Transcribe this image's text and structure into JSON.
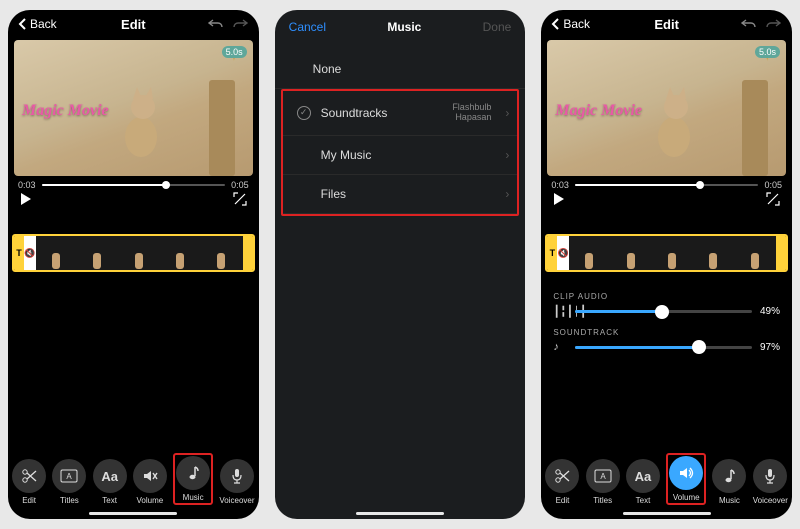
{
  "panel1": {
    "nav": {
      "back": "Back",
      "title": "Edit"
    },
    "preview": {
      "badge": "5.0s",
      "overlay": "Magic Movie"
    },
    "scrubber": {
      "current": "0:03",
      "total": "0:05"
    },
    "toolbar": [
      {
        "id": "edit",
        "label": "Edit",
        "icon": "scissors",
        "active": false
      },
      {
        "id": "titles",
        "label": "Titles",
        "icon": "titles",
        "active": false
      },
      {
        "id": "text",
        "label": "Text",
        "icon": "text",
        "active": false
      },
      {
        "id": "volume",
        "label": "Volume",
        "icon": "speaker-off",
        "active": false
      },
      {
        "id": "music",
        "label": "Music",
        "icon": "note",
        "active": false,
        "highlight": true
      },
      {
        "id": "voiceover",
        "label": "Voiceover",
        "icon": "mic",
        "active": false
      }
    ]
  },
  "panel2": {
    "nav": {
      "cancel": "Cancel",
      "title": "Music",
      "done": "Done"
    },
    "rows": [
      {
        "label": "None",
        "check": false,
        "sub": "",
        "chevron": false
      },
      {
        "label": "Soundtracks",
        "check": true,
        "sub1": "Flashbulb",
        "sub2": "Hapasan",
        "chevron": true
      },
      {
        "label": "My Music",
        "check": false,
        "sub": "",
        "chevron": true
      },
      {
        "label": "Files",
        "check": false,
        "sub": "",
        "chevron": true
      }
    ]
  },
  "panel3": {
    "nav": {
      "back": "Back",
      "title": "Edit"
    },
    "preview": {
      "badge": "5.0s",
      "overlay": "Magic Movie"
    },
    "scrubber": {
      "current": "0:03",
      "total": "0:05"
    },
    "volumes": {
      "clip": {
        "label": "CLIP AUDIO",
        "pct": "49%",
        "fill": 49
      },
      "track": {
        "label": "SOUNDTRACK",
        "pct": "97%",
        "fill": 70
      }
    },
    "toolbar": [
      {
        "id": "edit",
        "label": "Edit",
        "icon": "scissors",
        "active": false
      },
      {
        "id": "titles",
        "label": "Titles",
        "icon": "titles",
        "active": false
      },
      {
        "id": "text",
        "label": "Text",
        "icon": "text",
        "active": false
      },
      {
        "id": "volume",
        "label": "Volume",
        "icon": "speaker",
        "active": true,
        "highlight": true
      },
      {
        "id": "music",
        "label": "Music",
        "icon": "note",
        "active": false
      },
      {
        "id": "voiceover",
        "label": "Voiceover",
        "icon": "mic",
        "active": false
      }
    ]
  }
}
